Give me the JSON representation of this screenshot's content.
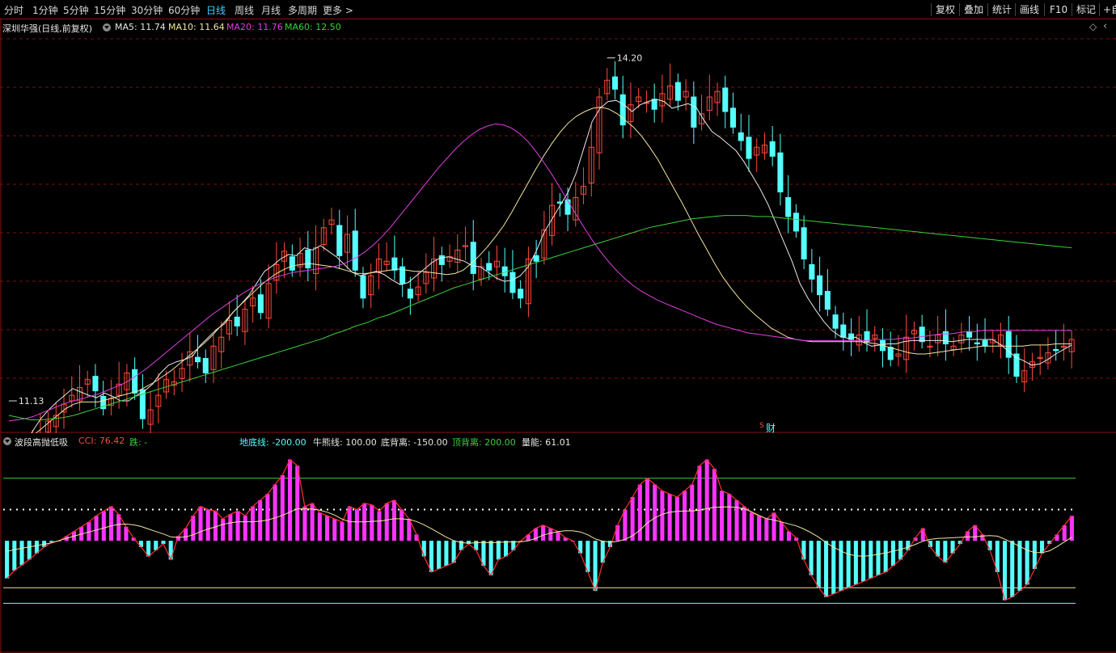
{
  "toolbar": {
    "periods": [
      "分时",
      "1分钟",
      "5分钟",
      "15分钟",
      "30分钟",
      "60分钟",
      "日线",
      "周线",
      "月线",
      "多周期",
      "更多 >"
    ],
    "active_period": "日线",
    "right_buttons": [
      "复权",
      "叠加",
      "统计",
      "画线",
      "F10",
      "标记",
      "+自"
    ]
  },
  "main_header": {
    "stock": "深圳华强(日线,前复权)",
    "ma5": "MA5: 11.74",
    "ma10": "MA10: 11.64",
    "ma20": "MA20: 11.76",
    "ma60": "MA60: 12.50",
    "diamond": "◇",
    "caret": "‹"
  },
  "indicator_header": {
    "name": "波段高抛低吸",
    "cci": "CCI: 76.42",
    "die": "跌: -",
    "didi": "地底线: -200.00",
    "niuxiong": "牛熊线: 100.00",
    "dibeili": "底背离: -150.00",
    "dingbeili": "顶背离: 200.00",
    "liangneng": "量能: 61.01"
  },
  "markers": {
    "cai": "财",
    "s_mark": "S"
  },
  "colors": {
    "up": "#ff4a3a",
    "down": "#54ffff",
    "ma5": "#e8e8e8",
    "ma10": "#f2e6a0",
    "ma20": "#e040e0",
    "ma60": "#3ccf3c",
    "grid": "#7a1010",
    "pos_bar": "#ff33ff"
  },
  "chart_data": [
    {
      "type": "candlestick",
      "title": "深圳华强(日线,前复权)",
      "annotations": {
        "max": "14.20",
        "min": "11.13"
      },
      "ohlc_close": [
        10.28,
        10.45,
        10.62,
        10.7,
        10.82,
        10.95,
        11.0,
        11.1,
        11.18,
        11.25,
        11.32,
        11.22,
        11.06,
        11.15,
        11.28,
        11.38,
        11.2,
        10.97,
        11.05,
        11.18,
        11.32,
        11.3,
        11.42,
        11.57,
        11.48,
        11.38,
        11.62,
        11.7,
        11.85,
        11.8,
        11.95,
        12.05,
        11.92,
        12.18,
        12.35,
        12.47,
        12.3,
        12.45,
        12.32,
        12.5,
        12.68,
        12.75,
        12.43,
        12.62,
        12.3,
        12.05,
        12.25,
        12.4,
        12.38,
        12.3,
        12.18,
        12.05,
        12.15,
        12.28,
        12.4,
        12.35,
        12.42,
        12.48,
        12.52,
        12.27,
        12.33,
        12.3,
        12.38,
        12.25,
        12.1,
        12.05,
        12.4,
        12.38,
        12.66,
        12.88,
        12.9,
        12.8,
        12.95,
        13.05,
        13.4,
        13.85,
        14.0,
        13.92,
        13.6,
        13.78,
        13.85,
        13.8,
        13.74,
        13.88,
        13.95,
        13.82,
        13.9,
        13.58,
        13.7,
        13.85,
        13.9,
        13.72,
        13.58,
        13.46,
        13.3,
        13.4,
        13.42,
        13.32,
        13.0,
        12.78,
        12.65,
        12.4,
        12.22,
        12.08,
        11.95,
        11.78,
        11.7,
        11.68,
        11.72,
        11.66,
        11.72,
        11.58,
        11.5,
        11.55,
        11.7,
        11.76,
        11.66,
        11.62,
        11.72,
        11.64,
        11.62,
        11.72,
        11.7,
        11.64,
        11.62,
        11.68,
        11.72,
        11.52,
        11.35,
        11.4,
        11.48,
        11.52,
        11.56,
        11.58,
        11.62,
        11.68
      ],
      "ylim": [
        11.0,
        14.4
      ],
      "series": [
        {
          "name": "MA5",
          "values": [
            10.58,
            10.65,
            10.74,
            10.86,
            10.97,
            11.05,
            11.12,
            11.18,
            11.24,
            11.21,
            11.18,
            11.16,
            11.2,
            11.17,
            11.13,
            11.13,
            11.18,
            11.22,
            11.28,
            11.38,
            11.45,
            11.48,
            11.5,
            11.53,
            11.63,
            11.7,
            11.77,
            11.82,
            11.92,
            11.99,
            12.07,
            12.18,
            12.29,
            12.34,
            12.4,
            12.44,
            12.43,
            12.5,
            12.48,
            12.52,
            12.47,
            12.42,
            12.35,
            12.28,
            12.25,
            12.27,
            12.29,
            12.26,
            12.21,
            12.17,
            12.19,
            12.25,
            12.31,
            12.37,
            12.41,
            12.42,
            12.4,
            12.38,
            12.34,
            12.33,
            12.28,
            12.23,
            12.2,
            12.21,
            12.25,
            12.33,
            12.47,
            12.64,
            12.76,
            12.88,
            13.0,
            13.17,
            13.4,
            13.63,
            13.75,
            13.81,
            13.82,
            13.78,
            13.72,
            13.78,
            13.81,
            13.83,
            13.81,
            13.75,
            13.77,
            13.79,
            13.76,
            13.64,
            13.54,
            13.49,
            13.43,
            13.37,
            13.27,
            13.15,
            13.03,
            12.89,
            12.72,
            12.55,
            12.38,
            12.18,
            12.05,
            11.94,
            11.84,
            11.76,
            11.71,
            11.69,
            11.7,
            11.65,
            11.62,
            11.63,
            11.64,
            11.64,
            11.66,
            11.67,
            11.67,
            11.67,
            11.67,
            11.67,
            11.66,
            11.67,
            11.68,
            11.68,
            11.68,
            11.68,
            11.64,
            11.58,
            11.52,
            11.49,
            11.45,
            11.46,
            11.5,
            11.55,
            11.59,
            11.63
          ]
        },
        {
          "name": "MA10",
          "values": [
            10.7,
            10.72,
            10.76,
            10.82,
            10.88,
            10.94,
            11.0,
            11.06,
            11.1,
            11.12,
            11.12,
            11.12,
            11.14,
            11.16,
            11.18,
            11.2,
            11.22,
            11.26,
            11.3,
            11.35,
            11.4,
            11.46,
            11.52,
            11.58,
            11.64,
            11.71,
            11.79,
            11.87,
            11.95,
            12.02,
            12.09,
            12.16,
            12.22,
            12.27,
            12.31,
            12.34,
            12.35,
            12.36,
            12.35,
            12.34,
            12.33,
            12.31,
            12.29,
            12.27,
            12.27,
            12.28,
            12.29,
            12.3,
            12.31,
            12.3,
            12.29,
            12.29,
            12.28,
            12.27,
            12.26,
            12.27,
            12.3,
            12.36,
            12.43,
            12.51,
            12.6,
            12.7,
            12.82,
            12.95,
            13.08,
            13.21,
            13.33,
            13.44,
            13.54,
            13.62,
            13.68,
            13.72,
            13.75,
            13.76,
            13.74,
            13.7,
            13.64,
            13.58,
            13.5,
            13.4,
            13.29,
            13.16,
            13.03,
            12.9,
            12.76,
            12.62,
            12.49,
            12.36,
            12.24,
            12.14,
            12.05,
            11.97,
            11.9,
            11.84,
            11.78,
            11.74,
            11.7,
            11.68,
            11.67,
            11.66,
            11.66,
            11.66,
            11.66,
            11.66,
            11.66,
            11.66,
            11.65,
            11.64,
            11.62,
            11.6,
            11.58,
            11.56,
            11.55,
            11.55,
            11.56,
            11.57,
            11.58,
            11.59,
            11.6,
            11.61,
            11.62,
            11.62,
            11.62,
            11.62,
            11.62,
            11.62,
            11.63,
            11.63,
            11.63,
            11.64,
            11.64,
            11.64
          ]
        },
        {
          "name": "MA20",
          "values": [
            10.95,
            10.96,
            10.97,
            10.99,
            11.02,
            11.05,
            11.08,
            11.11,
            11.13,
            11.15,
            11.17,
            11.19,
            11.22,
            11.25,
            11.28,
            11.32,
            11.37,
            11.42,
            11.48,
            11.54,
            11.6,
            11.66,
            11.72,
            11.78,
            11.84,
            11.9,
            11.95,
            12.0,
            12.05,
            12.1,
            12.14,
            12.18,
            12.21,
            12.24,
            12.26,
            12.28,
            12.29,
            12.3,
            12.31,
            12.32,
            12.33,
            12.35,
            12.38,
            12.42,
            12.47,
            12.53,
            12.6,
            12.68,
            12.77,
            12.86,
            12.95,
            13.04,
            13.13,
            13.22,
            13.3,
            13.38,
            13.45,
            13.51,
            13.56,
            13.59,
            13.61,
            13.6,
            13.57,
            13.52,
            13.45,
            13.36,
            13.26,
            13.15,
            13.03,
            12.91,
            12.79,
            12.67,
            12.56,
            12.46,
            12.37,
            12.29,
            12.22,
            12.16,
            12.11,
            12.07,
            12.03,
            12.0,
            11.97,
            11.94,
            11.91,
            11.88,
            11.85,
            11.82,
            11.8,
            11.78,
            11.76,
            11.74,
            11.73,
            11.72,
            11.71,
            11.7,
            11.69,
            11.68,
            11.67,
            11.67,
            11.67,
            11.67,
            11.67,
            11.67,
            11.67,
            11.67,
            11.67,
            11.68,
            11.68,
            11.68,
            11.69,
            11.69,
            11.7,
            11.71,
            11.72,
            11.73,
            11.73,
            11.74,
            11.75,
            11.75,
            11.76,
            11.76,
            11.76,
            11.76,
            11.76,
            11.76,
            11.76,
            11.76,
            11.76,
            11.76,
            11.76,
            11.76
          ]
        },
        {
          "name": "MA60",
          "values": [
            11.0,
            10.98,
            10.96,
            10.96,
            10.97,
            10.98,
            11.0,
            11.03,
            11.06,
            11.09,
            11.12,
            11.15,
            11.18,
            11.21,
            11.24,
            11.27,
            11.3,
            11.33,
            11.36,
            11.39,
            11.42,
            11.45,
            11.48,
            11.51,
            11.54,
            11.57,
            11.6,
            11.63,
            11.66,
            11.69,
            11.73,
            11.76,
            11.8,
            11.83,
            11.87,
            11.9,
            11.94,
            11.98,
            12.02,
            12.06,
            12.1,
            12.14,
            12.17,
            12.2,
            12.23,
            12.26,
            12.29,
            12.32,
            12.35,
            12.38,
            12.41,
            12.44,
            12.47,
            12.5,
            12.53,
            12.56,
            12.59,
            12.62,
            12.65,
            12.68,
            12.7,
            12.72,
            12.74,
            12.76,
            12.77,
            12.78,
            12.79,
            12.79,
            12.79,
            12.78,
            12.78,
            12.77,
            12.76,
            12.75,
            12.74,
            12.73,
            12.72,
            12.71,
            12.7,
            12.69,
            12.68,
            12.67,
            12.66,
            12.65,
            12.64,
            12.63,
            12.62,
            12.61,
            12.6,
            12.59,
            12.58,
            12.57,
            12.56,
            12.55,
            12.54,
            12.53,
            12.52,
            12.51,
            12.5
          ]
        }
      ]
    },
    {
      "type": "bar",
      "title": "波段高抛低吸",
      "ylim": [
        -240,
        290
      ],
      "reference_lines": {
        "地底线": -200,
        "牛熊线": 100,
        "底背离": -150,
        "顶背离": 200
      },
      "values": [
        -120,
        -95,
        -78,
        -60,
        -40,
        -20,
        -5,
        0,
        15,
        30,
        45,
        60,
        80,
        95,
        110,
        85,
        45,
        10,
        -20,
        -50,
        -30,
        -10,
        -60,
        15,
        40,
        80,
        110,
        100,
        95,
        70,
        85,
        95,
        80,
        110,
        130,
        150,
        180,
        210,
        260,
        240,
        110,
        120,
        90,
        80,
        70,
        60,
        110,
        100,
        120,
        115,
        95,
        120,
        130,
        100,
        70,
        20,
        -50,
        -100,
        -90,
        -80,
        -70,
        -30,
        -10,
        -30,
        -80,
        -110,
        -60,
        -50,
        -30,
        0,
        20,
        40,
        50,
        40,
        30,
        10,
        0,
        -40,
        -100,
        -160,
        -70,
        -20,
        50,
        100,
        140,
        180,
        200,
        180,
        160,
        150,
        140,
        160,
        180,
        240,
        260,
        230,
        160,
        150,
        130,
        110,
        90,
        80,
        70,
        90,
        60,
        30,
        10,
        -60,
        -110,
        -150,
        -180,
        -170,
        -160,
        -150,
        -140,
        -130,
        -120,
        -110,
        -100,
        -80,
        -60,
        -30,
        10,
        40,
        -20,
        -50,
        -70,
        -40,
        -10,
        30,
        50,
        20,
        -30,
        -100,
        -190,
        -180,
        -160,
        -140,
        -90,
        -40,
        -10,
        20,
        50,
        80
      ]
    }
  ]
}
